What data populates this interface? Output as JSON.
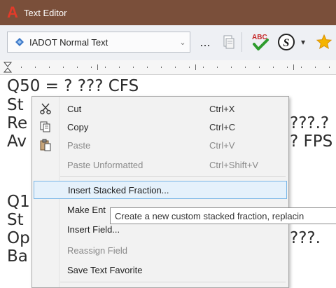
{
  "window": {
    "title": "Text Editor",
    "logo_letter": "A"
  },
  "toolbar": {
    "style_combo": {
      "value": "IADOT Normal Text"
    },
    "ellipsis_label": "...",
    "spellcheck_label": "ABC",
    "symbol_label": "S",
    "icons": [
      "paste-special-icon",
      "spellcheck-icon",
      "special-symbol-icon",
      "favorite-star-icon"
    ]
  },
  "document": {
    "lines": [
      "Q50  =  ? ??? CFS",
      "St",
      "Re",
      "Av",
      "Q1",
      "St",
      "Op",
      "Ba"
    ],
    "right_fragments": [
      "???.?",
      "?  FPS",
      "???."
    ]
  },
  "context_menu": {
    "items": [
      {
        "label": "Cut",
        "shortcut": "Ctrl+X",
        "icon": "scissors-icon",
        "enabled": true
      },
      {
        "label": "Copy",
        "shortcut": "Ctrl+C",
        "icon": "copy-icon",
        "enabled": true
      },
      {
        "label": "Paste",
        "shortcut": "Ctrl+V",
        "icon": "paste-icon",
        "enabled": false
      },
      {
        "label": "Paste Unformatted",
        "shortcut": "Ctrl+Shift+V",
        "icon": "",
        "enabled": false
      },
      {
        "label": "Insert Stacked Fraction...",
        "shortcut": "",
        "icon": "",
        "enabled": true,
        "highlighted": true
      },
      {
        "label": "Make Ent",
        "shortcut": "",
        "icon": "",
        "enabled": true
      },
      {
        "label": "Insert Field...",
        "shortcut": "",
        "icon": "",
        "enabled": true
      },
      {
        "label": "Reassign Field",
        "shortcut": "",
        "icon": "",
        "enabled": false
      },
      {
        "label": "Save Text Favorite",
        "shortcut": "",
        "icon": "",
        "enabled": true
      }
    ]
  },
  "tooltip": {
    "text": "Create a new custom stacked fraction, replacin"
  }
}
